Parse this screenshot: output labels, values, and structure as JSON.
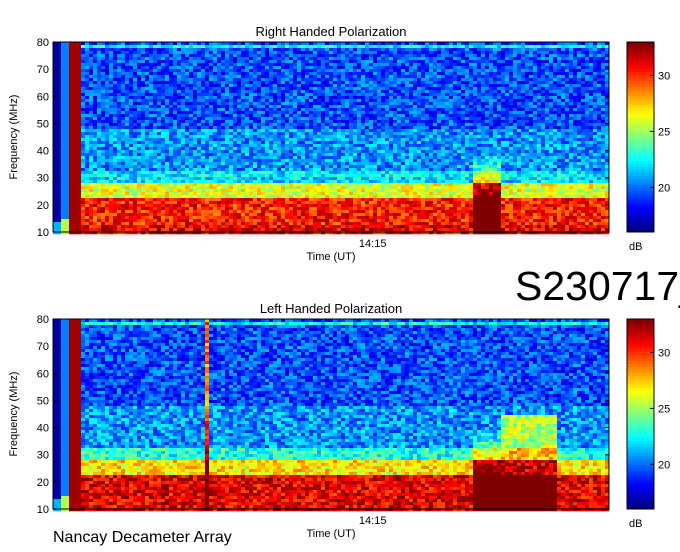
{
  "station_code": "S230717_",
  "footer": "Nancay Decameter Array",
  "chart_data": [
    {
      "type": "heatmap",
      "title": "Right Handed Polarization",
      "xlabel": "Time (UT)",
      "ylabel": "Frequency (MHz)",
      "x_ticks": [
        "14:15"
      ],
      "ylim": [
        10,
        80
      ],
      "y_ticks": [
        10,
        20,
        30,
        40,
        50,
        60,
        70,
        80
      ],
      "colorbar": {
        "label": "dB",
        "range": [
          16,
          33
        ],
        "ticks": [
          20,
          25,
          30
        ],
        "colormap": "jet"
      }
    },
    {
      "type": "heatmap",
      "title": "Left Handed Polarization",
      "xlabel": "Time (UT)",
      "ylabel": "Frequency (MHz)",
      "x_ticks": [
        "14:15"
      ],
      "ylim": [
        10,
        80
      ],
      "y_ticks": [
        10,
        20,
        30,
        40,
        50,
        60,
        70,
        80
      ],
      "colorbar": {
        "label": "dB",
        "range": [
          16,
          33
        ],
        "ticks": [
          20,
          25,
          30
        ],
        "colormap": "jet"
      }
    }
  ]
}
